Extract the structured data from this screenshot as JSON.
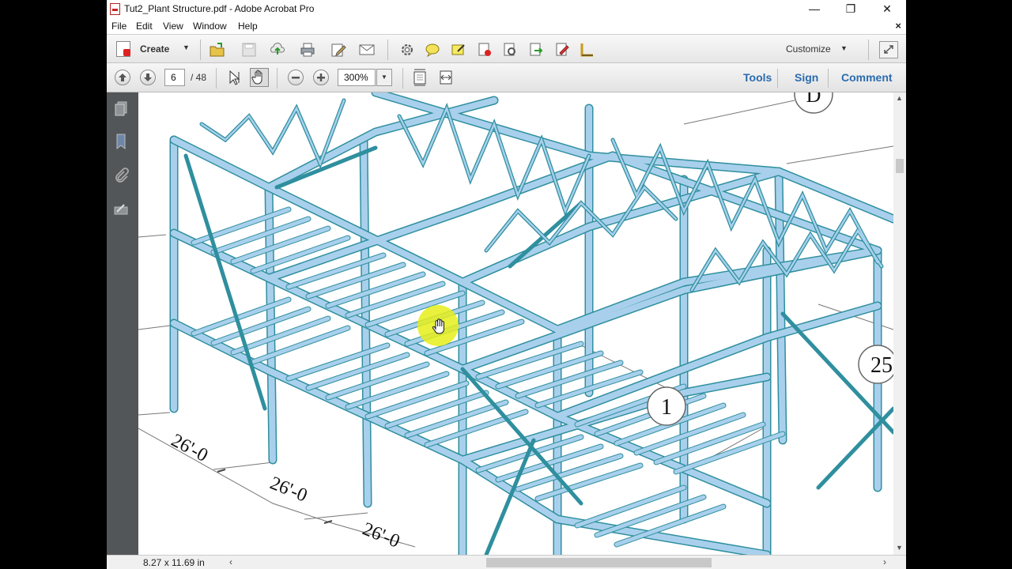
{
  "window": {
    "title": "Tut2_Plant Structure.pdf - Adobe Acrobat Pro",
    "minimize": "—",
    "restore": "❐",
    "close": "✕"
  },
  "menu": {
    "items": [
      "File",
      "Edit",
      "View",
      "Window",
      "Help"
    ],
    "close_doc": "×"
  },
  "toolbar": {
    "create_label": "Create",
    "customize_label": "Customize",
    "icons": [
      "open-icon",
      "save-icon",
      "upload-icon",
      "print-icon",
      "edit-icon",
      "email-icon",
      "gear-icon",
      "comment-icon",
      "highlight-icon",
      "stamp-icon",
      "properties-icon",
      "export-icon",
      "sign-icon",
      "measure-icon"
    ]
  },
  "nav": {
    "page_current": "6",
    "page_total": "/ 48",
    "zoom": "300%",
    "tools_label": "Tools",
    "sign_label": "Sign",
    "comment_label": "Comment"
  },
  "drawing": {
    "dim1": "26'-0",
    "dim2": "26'-0",
    "dim3": "26'-0",
    "bubble1": "1",
    "bubble2": "25",
    "bubble3": "D"
  },
  "status": {
    "page_size": "8.27 x 11.69 in"
  },
  "colors": {
    "steel_fill": "#a8d0ec",
    "steel_edge": "#2f8f9e",
    "link": "#2a6cb0",
    "cursor_highlight": "#e6ee1a"
  }
}
